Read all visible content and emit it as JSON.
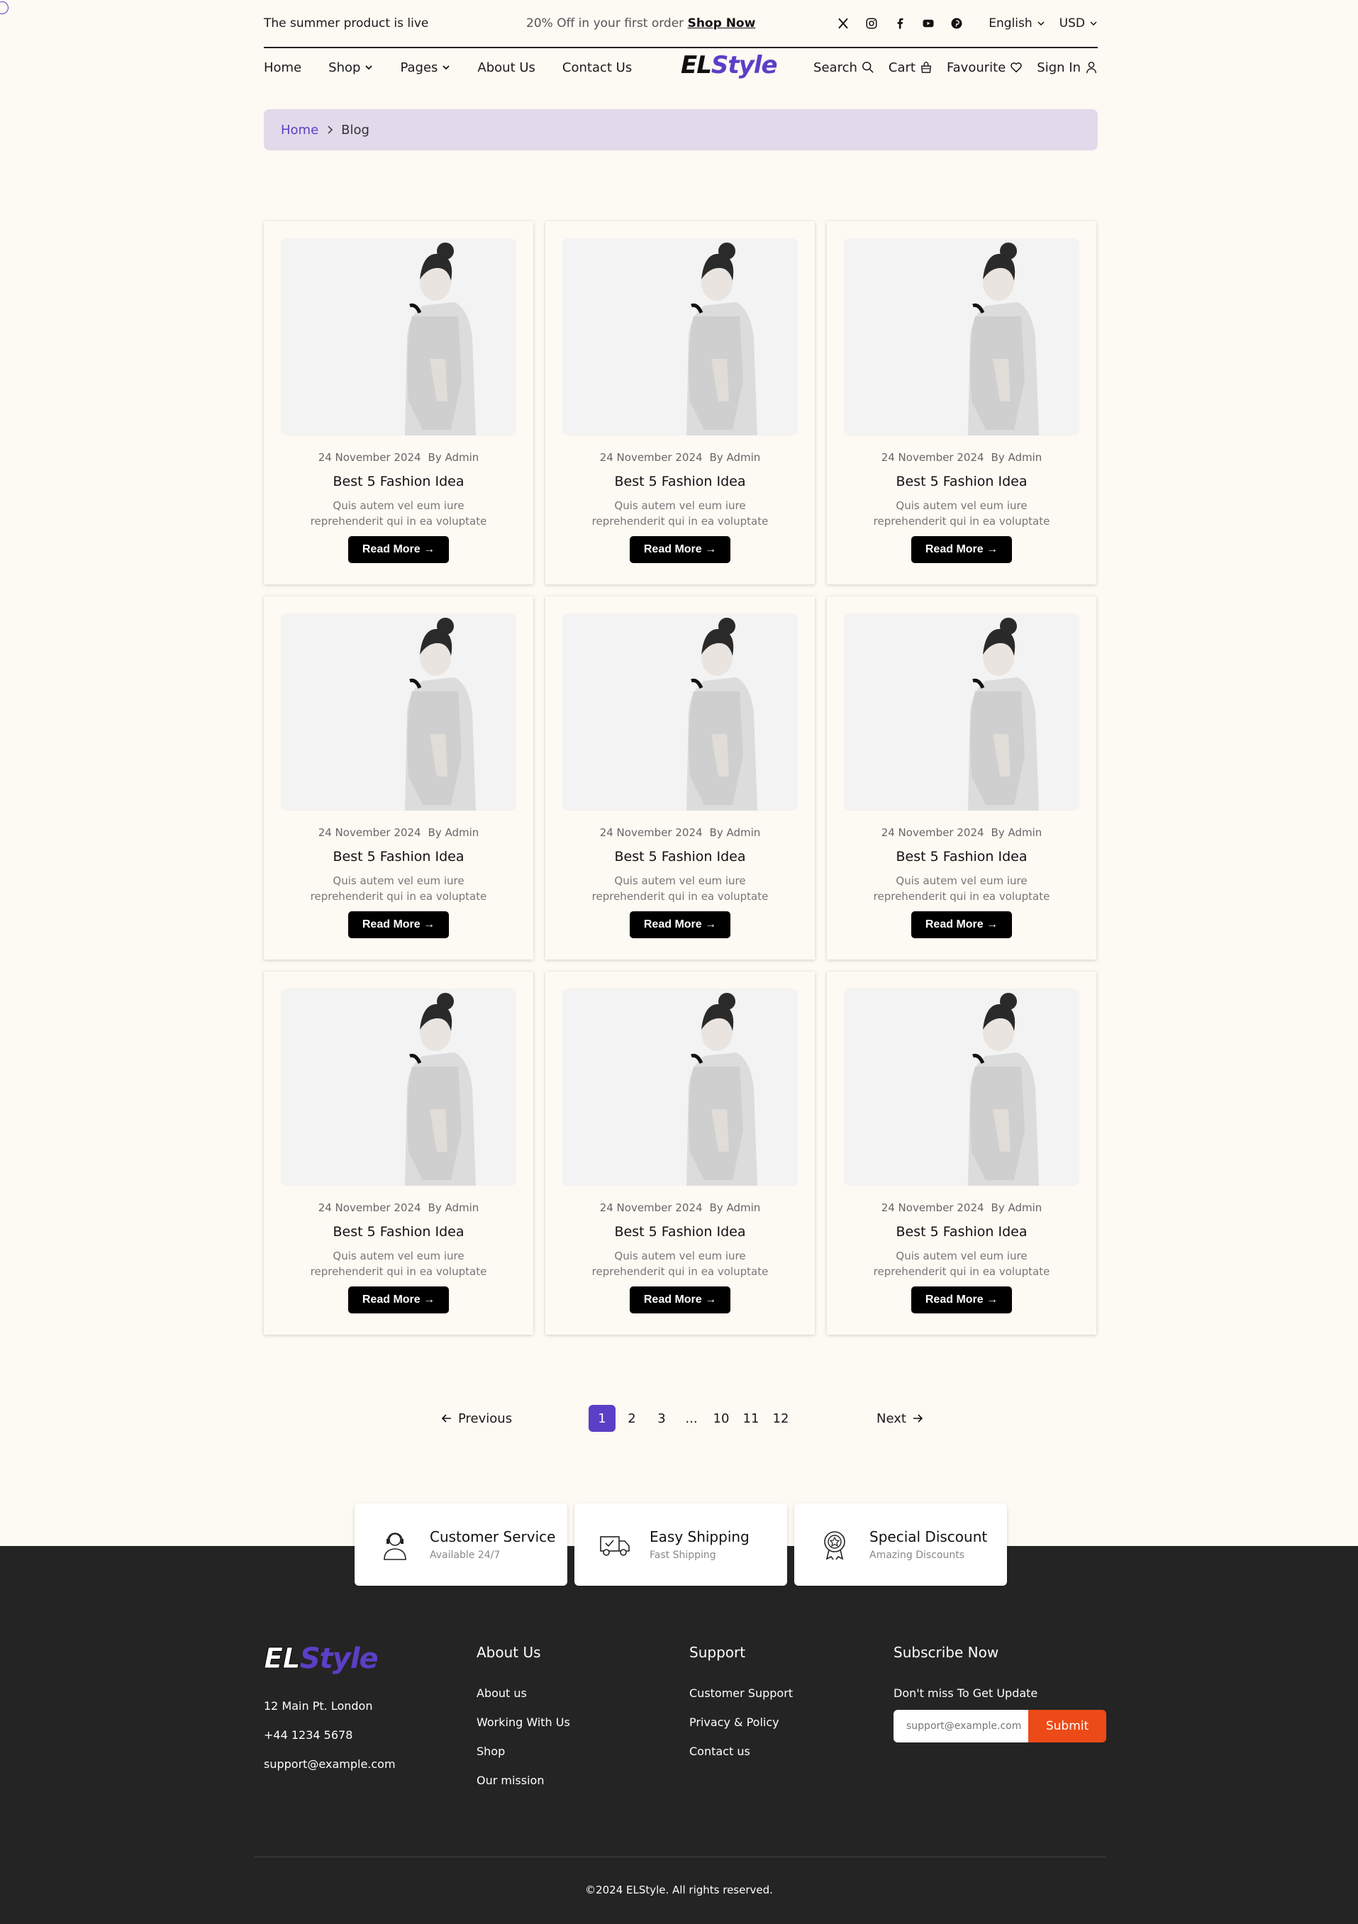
{
  "topbar": {
    "announcement": "The summer product is live",
    "promo_text": "20% Off in your first order",
    "promo_link": "Shop Now",
    "language": "English",
    "currency": "USD",
    "social_icons": [
      "x-icon",
      "instagram-icon",
      "facebook-icon",
      "youtube-icon",
      "pinterest-icon"
    ]
  },
  "nav": {
    "home": "Home",
    "shop": "Shop",
    "pages": "Pages",
    "about": "About Us",
    "contact": "Contact Us",
    "logo_el": "EL",
    "logo_style": "Style",
    "search": "Search",
    "cart": "Cart",
    "favourite": "Favourite",
    "signin": "Sign In"
  },
  "breadcrumb": {
    "home": "Home",
    "current": "Blog"
  },
  "posts": [
    {
      "date": "24 November 2024",
      "author": "By Admin",
      "title": "Best 5 Fashion Idea",
      "excerpt": "Quis autem vel eum iure reprehenderit qui in ea voluptate",
      "button": "Read More →"
    },
    {
      "date": "24 November 2024",
      "author": "By Admin",
      "title": "Best 5 Fashion Idea",
      "excerpt": "Quis autem vel eum iure reprehenderit qui in ea voluptate",
      "button": "Read More →"
    },
    {
      "date": "24 November 2024",
      "author": "By Admin",
      "title": "Best 5 Fashion Idea",
      "excerpt": "Quis autem vel eum iure reprehenderit qui in ea voluptate",
      "button": "Read More →"
    },
    {
      "date": "24 November 2024",
      "author": "By Admin",
      "title": "Best 5 Fashion Idea",
      "excerpt": "Quis autem vel eum iure reprehenderit qui in ea voluptate",
      "button": "Read More →"
    },
    {
      "date": "24 November 2024",
      "author": "By Admin",
      "title": "Best 5 Fashion Idea",
      "excerpt": "Quis autem vel eum iure reprehenderit qui in ea voluptate",
      "button": "Read More →"
    },
    {
      "date": "24 November 2024",
      "author": "By Admin",
      "title": "Best 5 Fashion Idea",
      "excerpt": "Quis autem vel eum iure reprehenderit qui in ea voluptate",
      "button": "Read More →"
    },
    {
      "date": "24 November 2024",
      "author": "By Admin",
      "title": "Best 5 Fashion Idea",
      "excerpt": "Quis autem vel eum iure reprehenderit qui in ea voluptate",
      "button": "Read More →"
    },
    {
      "date": "24 November 2024",
      "author": "By Admin",
      "title": "Best 5 Fashion Idea",
      "excerpt": "Quis autem vel eum iure reprehenderit qui in ea voluptate",
      "button": "Read More →"
    },
    {
      "date": "24 November 2024",
      "author": "By Admin",
      "title": "Best 5 Fashion Idea",
      "excerpt": "Quis autem vel eum iure reprehenderit qui in ea voluptate",
      "button": "Read More →"
    }
  ],
  "pagination": {
    "previous": "Previous",
    "next": "Next",
    "pages": [
      "1",
      "2",
      "3",
      "...",
      "10",
      "11",
      "12"
    ],
    "current": "1"
  },
  "features": [
    {
      "title": "Customer Service",
      "subtitle": "Available 24/7",
      "icon": "headset-agent-icon"
    },
    {
      "title": "Easy Shipping",
      "subtitle": "Fast Shipping",
      "icon": "delivery-truck-icon"
    },
    {
      "title": "Special Discount",
      "subtitle": "Amazing Discounts",
      "icon": "award-badge-icon"
    }
  ],
  "footer": {
    "logo_el": "EL",
    "logo_style": "Style",
    "address": "12 Main Pt. London",
    "phone": "+44 1234 5678",
    "email": "support@example.com",
    "about_title": "About Us",
    "about_links": [
      "About us",
      "Working With Us",
      "Shop",
      "Our mission"
    ],
    "support_title": "Support",
    "support_links": [
      "Customer Support",
      "Privacy & Policy",
      "Contact us"
    ],
    "subscribe_title": "Subscribe Now",
    "subscribe_text": "Don't miss To Get Update",
    "subscribe_placeholder": "support@example.com",
    "subscribe_button": "Submit",
    "copyright": "©2024 ELStyle. All rights reserved."
  },
  "colors": {
    "accent": "#5b3fc6",
    "background": "#fdf9f3",
    "breadcrumb_bg": "#e2d9ea",
    "footer_bg": "#242424",
    "submit": "#ec4a17"
  }
}
